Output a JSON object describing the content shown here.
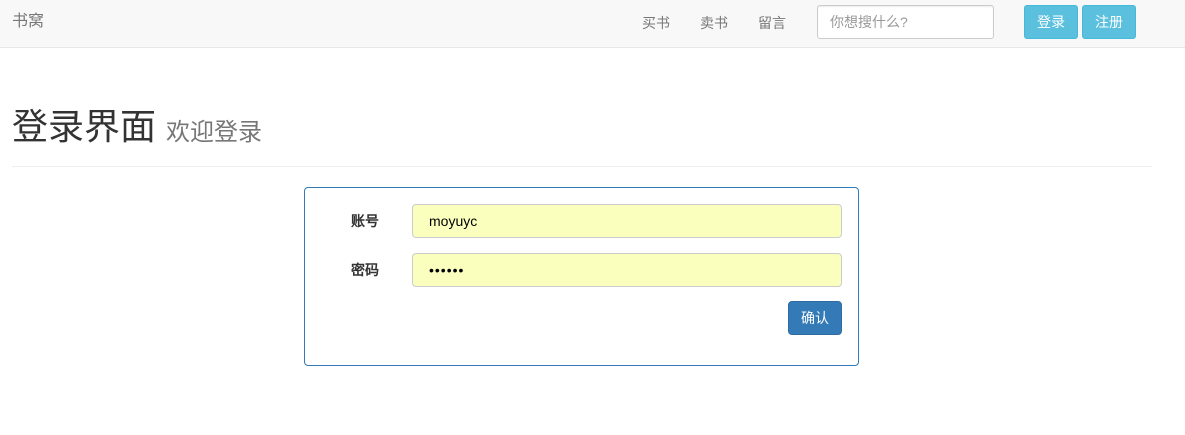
{
  "navbar": {
    "brand": "书窝",
    "links": [
      {
        "label": "买书"
      },
      {
        "label": "卖书"
      },
      {
        "label": "留言"
      }
    ],
    "search": {
      "placeholder": "你想搜什么?",
      "value": ""
    },
    "login_label": "登录",
    "register_label": "注册",
    "accent_color": "#5bc0de"
  },
  "header": {
    "title": "登录界面",
    "subtitle": "欢迎登录"
  },
  "login_form": {
    "account_label": "账号",
    "account_value": "moyuyc",
    "password_label": "密码",
    "password_value": "••••••",
    "submit_label": "确认",
    "autofill_color": "#faffbd",
    "primary_color": "#337ab7"
  }
}
